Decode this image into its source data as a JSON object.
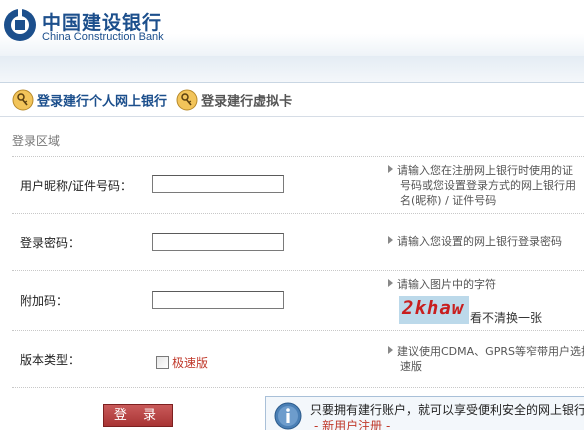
{
  "brand": {
    "name_cn": "中国建设银行",
    "name_en": "China Construction Bank",
    "color": "#1c4f8c"
  },
  "tabs": [
    {
      "label": "登录建行个人网上银行",
      "icon": "key-icon",
      "active": true
    },
    {
      "label": "登录建行虚拟卡",
      "icon": "key-icon",
      "active": false
    }
  ],
  "section": {
    "title": "登录区域"
  },
  "form": {
    "username": {
      "label": "用户昵称/证件号码：",
      "value": "",
      "hint_lines": [
        "请输入您在注册网上银行时使用的证",
        "号码或您设置登录方式的网上银行用",
        "名(昵称) / 证件号码"
      ]
    },
    "password": {
      "label": "登录密码：",
      "value": "",
      "hint_lines": [
        "请输入您设置的网上银行登录密码"
      ]
    },
    "captcha": {
      "label": "附加码：",
      "value": "",
      "hint_lines": [
        "请输入图片中的字符"
      ],
      "image_text": "2khaw",
      "refresh_label": "看不清换一张"
    },
    "version": {
      "label": "版本类型：",
      "option_label": "极速版",
      "checked": false,
      "hint_lines": [
        "建议使用CDMA、GPRS等窄带用户选择",
        "速版"
      ]
    }
  },
  "login_button": {
    "label": "登 录"
  },
  "info": {
    "text": "只要拥有建行账户，就可以享受便利安全的网上银行",
    "link": "- 新用户注册 -"
  },
  "colors": {
    "accent_red": "#a83434",
    "link_red": "#c0392b",
    "header_blue": "#1c4f8c"
  }
}
